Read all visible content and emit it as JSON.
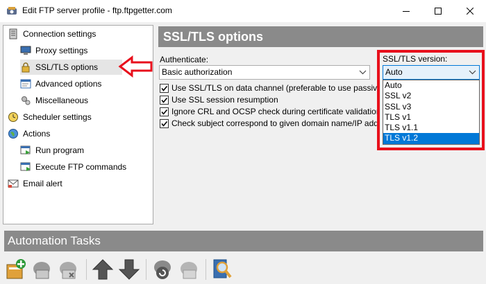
{
  "window": {
    "title": "Edit FTP server profile - ftp.ftpgetter.com"
  },
  "sidebar": {
    "items": [
      {
        "label": "Connection settings",
        "icon": "server-icon"
      },
      {
        "label": "Proxy settings",
        "icon": "monitor-icon"
      },
      {
        "label": "SSL/TLS options",
        "icon": "lock-icon",
        "selected": true
      },
      {
        "label": "Advanced options",
        "icon": "window-icon"
      },
      {
        "label": "Miscellaneous",
        "icon": "gears-icon"
      },
      {
        "label": "Scheduler settings",
        "icon": "clock-icon"
      },
      {
        "label": "Actions",
        "icon": "globe-icon"
      },
      {
        "label": "Run program",
        "icon": "run-icon"
      },
      {
        "label": "Execute FTP commands",
        "icon": "terminal-icon"
      },
      {
        "label": "Email alert",
        "icon": "email-icon"
      }
    ]
  },
  "panel": {
    "title": "SSL/TLS options",
    "authenticate_label": "Authenticate:",
    "authenticate_value": "Basic authorization",
    "version_label": "SSL/TLS version:",
    "version_value": "Auto",
    "version_options": [
      "Auto",
      "SSL v2",
      "SSL v3",
      "TLS v1",
      "TLS v1.1",
      "TLS v1.2"
    ],
    "version_highlighted": "TLS v1.2",
    "checkboxes": [
      {
        "label": "Use SSL/TLS on data channel (preferable to use passive m",
        "checked": true
      },
      {
        "label": "Use SSL session resumption",
        "checked": true
      },
      {
        "label": "Ignore CRL and OCSP check during certificate validation",
        "checked": true
      },
      {
        "label": "Check subject correspond to given domain name/IP addre",
        "checked": true
      }
    ]
  },
  "automation": {
    "title": "Automation Tasks",
    "toolbar_icons": [
      "add-task-icon",
      "edit-task-icon",
      "delete-task-icon",
      "move-up-icon",
      "move-down-icon",
      "run-task-icon",
      "stop-task-icon",
      "view-log-icon"
    ]
  },
  "colors": {
    "header_bg": "#8a8a8a",
    "highlight_red": "#e8101c",
    "selection_blue": "#0078d7"
  }
}
